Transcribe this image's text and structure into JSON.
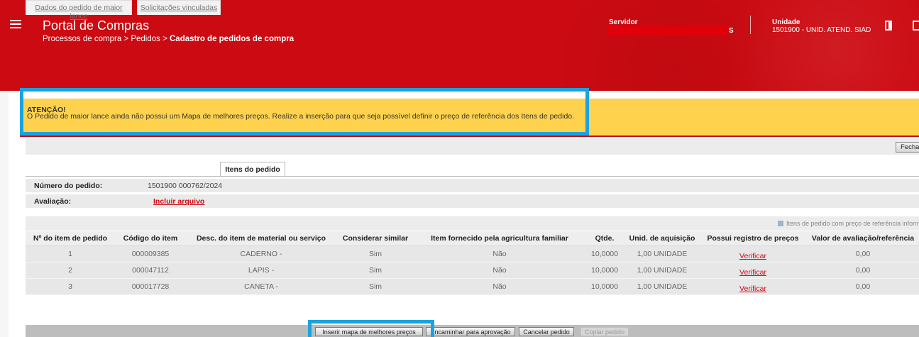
{
  "header": {
    "app_title": "Portal de Compras",
    "breadcrumb_path": "Processos de compra > Pedidos > ",
    "breadcrumb_current": "Cadastro de pedidos de compra",
    "servidor_label": "Servidor",
    "servidor_suffix": "S",
    "unidade_label": "Unidade",
    "unidade_value": "1501900 - UNID. ATEND. SIAD",
    "brand_color": "#cc0a12"
  },
  "alert": {
    "title": "ATENÇÃO!",
    "message": "O Pedido de maior lance ainda não possui um Mapa de melhores preços. Realize a inserção para que seja possível definir o preço de referência dos Itens de pedido.",
    "color": "#ffd24d"
  },
  "toolbar": {
    "close_label": "Fechar"
  },
  "tabs": [
    {
      "label": "Dados do pedido de maior lance",
      "active": false
    },
    {
      "label": "Solicitações vinculadas",
      "active": false
    },
    {
      "label": "Itens do pedido",
      "active": true
    }
  ],
  "info": {
    "order_number_label": "Número do pedido:",
    "order_number_value": "1501900 000762/2024",
    "evaluation_label": "Avaliação:",
    "evaluation_link": "Incluir arquivo"
  },
  "legend": {
    "text": "Itens de pedido com preço de referência informado"
  },
  "table": {
    "headers": [
      "Nº do item de pedido",
      "Código do item",
      "Desc. do item de material ou serviço",
      "Considerar similar",
      "Item fornecido pela agricultura familiar",
      "Qtde.",
      "Unid. de aquisição",
      "Possui registro de preços",
      "Valor de avaliação/referência"
    ],
    "rows": [
      {
        "num": "1",
        "code": "000009385",
        "desc": "CADERNO -",
        "similar": "Sim",
        "family": "Não",
        "qty": "10,0000",
        "unit": "1,00 UNIDADE",
        "price_reg": "Verificar",
        "value": "0,00"
      },
      {
        "num": "2",
        "code": "000047112",
        "desc": "LAPIS -",
        "similar": "Sim",
        "family": "Não",
        "qty": "10,0000",
        "unit": "1,00 UNIDADE",
        "price_reg": "Verificar",
        "value": "0,00"
      },
      {
        "num": "3",
        "code": "000017728",
        "desc": "CANETA -",
        "similar": "Sim",
        "family": "Não",
        "qty": "10,0000",
        "unit": "1,00 UNIDADE",
        "price_reg": "Verificar",
        "value": "0,00"
      }
    ]
  },
  "actions": {
    "insert_map": "Inserir mapa de melhores preços",
    "forward": "Encaminhar para aprovação",
    "cancel": "Cancelar pedido",
    "copy": "Copiar pedido"
  },
  "highlight_color": "#1aa3e0"
}
